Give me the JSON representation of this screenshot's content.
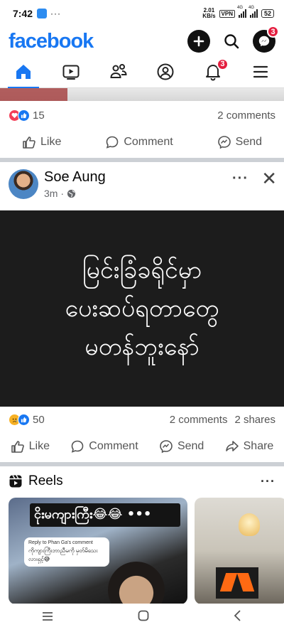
{
  "status_bar": {
    "time": "7:42",
    "dots": "···",
    "speed_top": "2.01",
    "speed_bottom": "KB/s",
    "vpn": "VPN",
    "net1": "4G",
    "net2": "4G",
    "battery": "52"
  },
  "header": {
    "logo": "facebook",
    "messenger_badge": "3"
  },
  "tabs": {
    "notifications_badge": "3",
    "active": "home"
  },
  "prev_post": {
    "reactions_count": "15",
    "comments": "2 comments",
    "like": "Like",
    "comment": "Comment",
    "send": "Send"
  },
  "post": {
    "author": "Soe Aung",
    "time": "3m ·",
    "more": "···",
    "close": "✕",
    "body_text": "မြင်းခြံခရိုင်မှာ\nပေးဆပ်ရတာတွေ\nမတန်ဘူးနော်",
    "reactions_count": "50",
    "comments": "2 comments",
    "shares": "2 shares",
    "like": "Like",
    "comment": "Comment",
    "send": "Send",
    "share": "Share"
  },
  "reels": {
    "title": "Reels",
    "more": "···",
    "reel1_caption": "ငိုးမကျားကြီး😂😂 •••",
    "reel1_reply": "Reply to Phan Ga's comment",
    "reel1_reply_text": "ကိုကျားကြီးဘာညီမကို မှတ်မိသေးလားရှင့်😅"
  },
  "colors": {
    "brand": "#1877f2",
    "badge": "#e41e3f",
    "love": "#f33e58",
    "like": "#1877f2",
    "sad": "#f7b125"
  }
}
